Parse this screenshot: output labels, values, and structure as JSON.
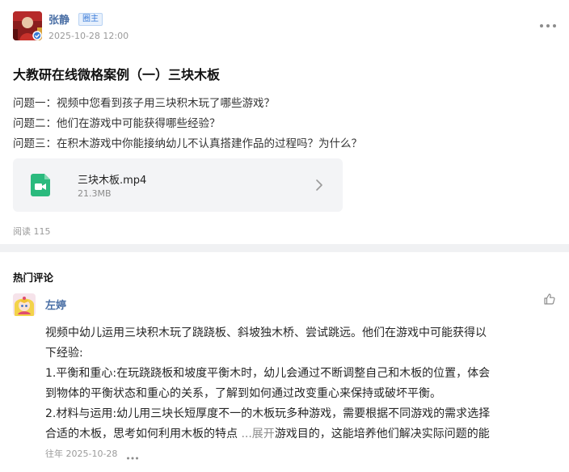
{
  "post": {
    "author": "张静",
    "badge": "圈主",
    "time": "2025-10-28 12:00",
    "title": "大教研在线微格案例（一）三块木板",
    "questions": [
      "问题一：视频中您看到孩子用三块积木玩了哪些游戏？",
      "问题二：他们在游戏中可能获得哪些经验？",
      "问题三：在积木游戏中你能接纳幼儿不认真搭建作品的过程吗？为什么？"
    ],
    "attachment": {
      "name": "三块木板.mp4",
      "size": "21.3MB",
      "icon": "video-file-icon",
      "color": "#2bba7e"
    },
    "read_count": "阅读 115"
  },
  "comments_section": {
    "title": "热门评论",
    "comments": [
      {
        "author": "左婷",
        "lines": [
          "视频中幼儿运用三块积木玩了跷跷板、斜坡独木桥、尝试跳远。他们在游戏中可能获得以",
          "下经验:",
          "1.平衡和重心:在玩跷跷板和坡度平衡木时，幼儿会通过不断调整自己和木板的位置，体会",
          "到物体的平衡状态和重心的关系，了解到如何通过改变重心来保持或破坏平衡。",
          "2.材料与运用:幼儿用三块长短厚度不一的木板玩多种游戏，需要根据不同游戏的需求选择"
        ],
        "last_line_start": "合适的木板，思考如何利用木板的特点",
        "expand_label": "...展开",
        "last_line_end": "游戏目的，这能培养他们解决实际问题的能",
        "time": "往年 2025-10-28"
      }
    ]
  },
  "colors": {
    "accent_name": "#4a6fa5",
    "divider": "#f0f1f3",
    "card_bg": "#f3f4f6"
  }
}
